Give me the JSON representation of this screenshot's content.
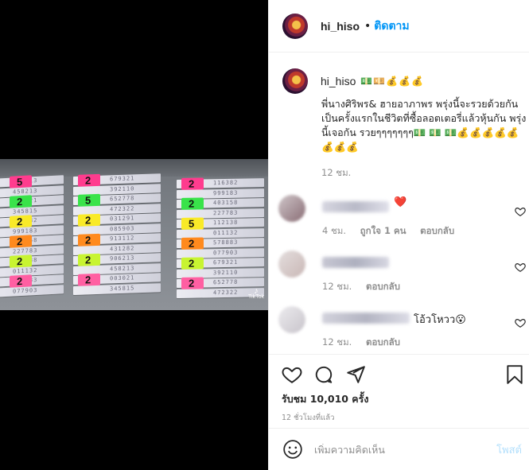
{
  "header": {
    "username": "hi_hiso",
    "separator": "•",
    "follow_label": "ติดตาม"
  },
  "caption": {
    "username": "hi_hiso",
    "emoji_inline": "💵💴💰💰💰",
    "text": "พี่นางศิริพร& ฮายอาภาพร พรุ่งนี้จะรวยด้วยกัน เป็นครั้งแรกในชีวิตที่ซื้อลอตเตอรี่แล้วหุ้นกัน พรุ่งนี้เจอกัน รวยๆๆๆๆๆๆๆ💵 💵 💵💰💰💰💰💰💰💰💰",
    "time": "12 ชม."
  },
  "comments": [
    {
      "text": "❤️",
      "time": "4 ชม.",
      "likes": "ถูกใจ 1 คน",
      "reply": "ตอบกลับ"
    },
    {
      "text": "",
      "time": "12 ชม.",
      "reply": "ตอบกลับ"
    },
    {
      "text": "โอ้วโหวว😮",
      "time": "12 ชม.",
      "reply": "ตอบกลับ"
    }
  ],
  "actions": {
    "icons": [
      "heart-icon",
      "comment-icon",
      "share-icon",
      "bookmark-icon"
    ],
    "views": "รับชม 10,010 ครั้ง",
    "posted_ago": "12 ชั่วโมงที่แล้ว"
  },
  "add_comment": {
    "placeholder": "เพิ่มความคิดเห็น",
    "post_label": "โพสต์"
  },
  "media": {
    "watermark": "TikTok",
    "ticket_numbers": [
      "906213",
      "458213",
      "003021",
      "345815",
      "116382",
      "999183",
      "403158",
      "227783",
      "112138",
      "011132",
      "578883",
      "077903",
      "679321",
      "392110",
      "652778",
      "472322",
      "031291",
      "085903",
      "913112",
      "431282"
    ],
    "tag_digits": [
      "5",
      "2",
      "2",
      "2",
      "2",
      "2",
      "2"
    ]
  },
  "colors": {
    "accent": "#0095f6",
    "post_disabled": "#b2dffc",
    "meta": "#8e8e8e",
    "heart": "#ed4956"
  }
}
